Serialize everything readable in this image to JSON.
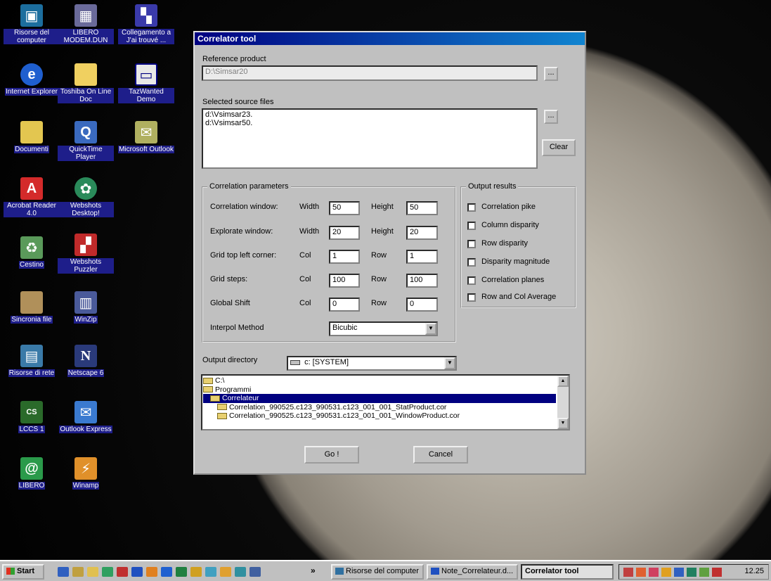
{
  "desktop": {
    "icons": [
      {
        "label": "Risorse del computer",
        "icon": "my-computer-icon"
      },
      {
        "label": "Internet Explorer",
        "icon": "internet-explorer-icon"
      },
      {
        "label": "Documenti",
        "icon": "documents-folder-icon"
      },
      {
        "label": "Acrobat Reader 4.0",
        "icon": "acrobat-reader-icon"
      },
      {
        "label": "Cestino",
        "icon": "recycle-bin-icon"
      },
      {
        "label": "Sincronia file",
        "icon": "briefcase-icon"
      },
      {
        "label": "Risorse di rete",
        "icon": "network-icon"
      },
      {
        "label": "LCCS 1",
        "icon": "lccs-icon"
      },
      {
        "label": "LIBERO",
        "icon": "libero-icon"
      },
      {
        "label": "LIBERO MODEM.DUN",
        "icon": "modem-icon"
      },
      {
        "label": "Toshiba On Line Doc",
        "icon": "folder-icon"
      },
      {
        "label": "QuickTime Player",
        "icon": "quicktime-icon"
      },
      {
        "label": "Webshots Desktop!",
        "icon": "webshots-icon"
      },
      {
        "label": "Webshots Puzzler",
        "icon": "puzzler-icon"
      },
      {
        "label": "WinZip",
        "icon": "winzip-icon"
      },
      {
        "label": "Netscape 6",
        "icon": "netscape-icon"
      },
      {
        "label": "Outlook Express",
        "icon": "outlook-express-icon"
      },
      {
        "label": "Winamp",
        "icon": "winamp-icon"
      },
      {
        "label": "Collegamento a J'ai trouvé ...",
        "icon": "shortcut-app-icon"
      },
      {
        "label": "TazWanted Demo",
        "icon": "window-app-icon"
      },
      {
        "label": "Microsoft Outlook",
        "icon": "outlook-icon"
      }
    ]
  },
  "window": {
    "title": "Correlator tool",
    "reference_label": "Reference product",
    "reference_value": "D:\\Simsar20",
    "browse_label": "...",
    "sources_label": "Selected source files",
    "sources": [
      "d:\\Vsimsar23.",
      "d:\\Vsimsar50."
    ],
    "clear_label": "Clear",
    "params": {
      "title": "Correlation parameters",
      "rows": [
        {
          "label": "Correlation window:",
          "l1": "Width",
          "v1": "50",
          "l2": "Height",
          "v2": "50"
        },
        {
          "label": "Explorate window:",
          "l1": "Width",
          "v1": "20",
          "l2": "Height",
          "v2": "20"
        },
        {
          "label": "Grid top left corner:",
          "l1": "Col",
          "v1": "1",
          "l2": "Row",
          "v2": "1"
        },
        {
          "label": "Grid steps:",
          "l1": "Col",
          "v1": "100",
          "l2": "Row",
          "v2": "100"
        },
        {
          "label": "Global Shift",
          "l1": "Col",
          "v1": "0",
          "l2": "Row",
          "v2": "0"
        }
      ],
      "interpol_label": "Interpol Method",
      "interpol_value": "Bicubic"
    },
    "output_results": {
      "title": "Output results",
      "options": [
        "Correlation pike",
        "Column disparity",
        "Row disparity",
        "Disparity magnitude",
        "Correlation planes",
        "Row and Col Average"
      ]
    },
    "output_dir_label": "Output directory",
    "drive_value": "c: [SYSTEM]",
    "tree": [
      "C:\\",
      "Programmi",
      "Correlateur",
      "Correlation_990525.c123_990531.c123_001_001_StatProduct.cor",
      "Correlation_990525.c123_990531.c123_001_001_WindowProduct.cor"
    ],
    "go_label": "Go !",
    "cancel_label": "Cancel"
  },
  "taskbar": {
    "start_label": "Start",
    "chevron": "»",
    "tasks": [
      "Risorse del computer",
      "Note_Correlateur.d...",
      "Correlator tool"
    ],
    "clock": "12.25"
  }
}
